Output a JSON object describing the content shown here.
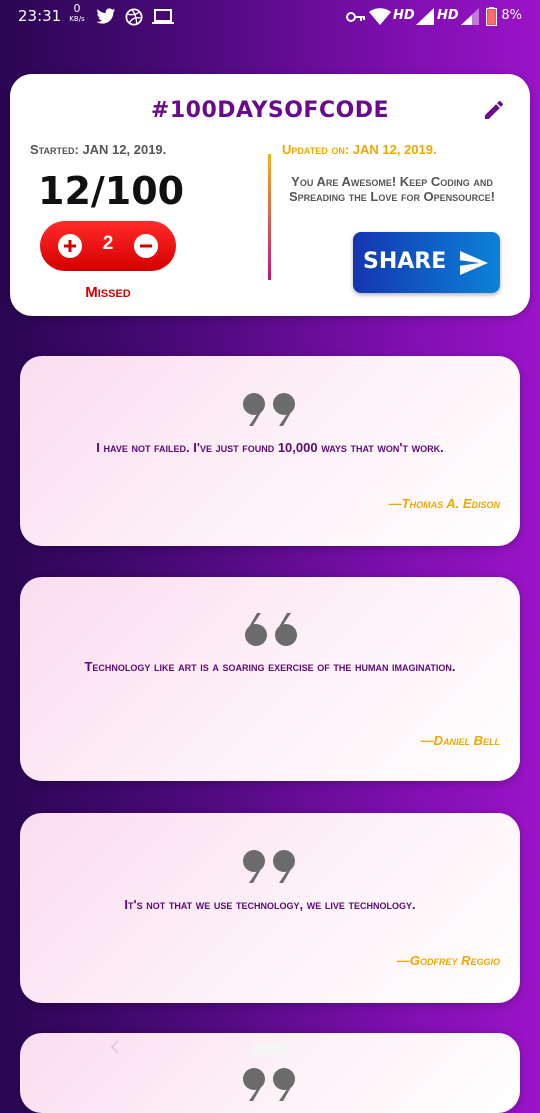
{
  "status_bar": {
    "time": "23:31",
    "net_speed_value": "0",
    "net_speed_unit": "KB/s",
    "hd1": "HD",
    "hd2": "HD",
    "battery": "8%"
  },
  "tracker": {
    "title": "#100DAYSOFCODE",
    "started": "Started: JAN 12, 2019.",
    "count": "12/100",
    "missed_value": "2",
    "missed_label": "Missed",
    "updated": "Updated on: JAN 12, 2019.",
    "message": "You Are Awesome! Keep Coding and Spreading the Love for Opensource!",
    "share_label": "SHARE"
  },
  "quotes": [
    {
      "text": "I have not failed. I've just found 10,000 ways that won't work.",
      "author": "—Thomas A. Edison",
      "mark": "close-quote"
    },
    {
      "text": "Technology like art is a soaring exercise of the human imagination.",
      "author": "—Daniel Bell",
      "mark": "open-quote"
    },
    {
      "text": "It's not that we use technology, we live technology.",
      "author": "—Godfrey Reggio",
      "mark": "close-quote"
    }
  ],
  "colors": {
    "accent_purple": "#6a0a8c",
    "missed_red": "#d40000",
    "updated_gold": "#f0a800",
    "share_blue": "#1436b0"
  },
  "icons": [
    "twitter-icon",
    "dribbble-icon",
    "laptop-icon",
    "key-icon",
    "wifi-icon",
    "signal-icon",
    "battery-icon",
    "edit-icon",
    "plus-icon",
    "minus-icon",
    "send-icon",
    "quote-icon"
  ]
}
